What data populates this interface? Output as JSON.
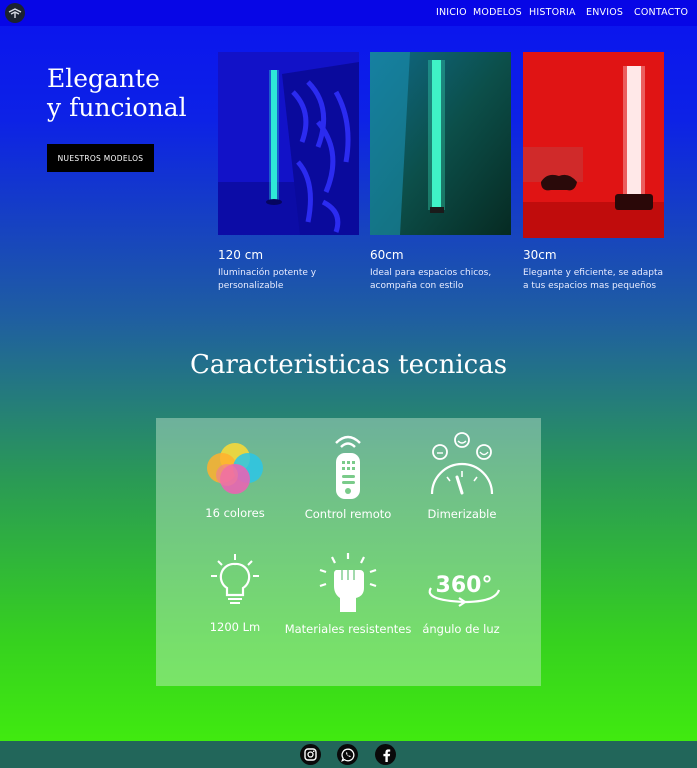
{
  "nav": {
    "links": [
      "INICIO",
      "MODELOS",
      "HISTORIA",
      "ENVIOS",
      "CONTACTO"
    ]
  },
  "hero": {
    "title_line1": "Elegante",
    "title_line2": "y funcional",
    "button_label": "NUESTROS MODELOS"
  },
  "models": [
    {
      "size": "120 cm",
      "description": "Iluminación potente y personalizable",
      "light_color": "#2ff0d8"
    },
    {
      "size": "60cm",
      "description": "Ideal para espacios chicos, acompaña con estilo",
      "light_color": "#40f5c8"
    },
    {
      "size": "30cm",
      "description": " Elegante y eficiente, se adapta a tus espacios mas pequeños",
      "light_color": "#ffd8d8"
    }
  ],
  "features": {
    "title": "Caracteristicas tecnicas",
    "items": [
      {
        "label": "16 colores",
        "icon": "color-circles-icon"
      },
      {
        "label": "Control remoto",
        "icon": "remote-control-icon"
      },
      {
        "label": "Dimerizable",
        "icon": "dimmer-gauge-icon"
      },
      {
        "label": "1200 Lm",
        "icon": "lightbulb-icon"
      },
      {
        "label": "Materiales resistentes",
        "icon": "fist-icon"
      },
      {
        "label": "ángulo de luz",
        "icon": "rotate-360-icon"
      }
    ]
  },
  "footer": {
    "social": [
      "instagram-icon",
      "whatsapp-icon",
      "facebook-icon"
    ]
  },
  "colors": {
    "nav_bg": "#0706e6",
    "footer_bg": "#22665a",
    "button_bg": "#000000"
  }
}
